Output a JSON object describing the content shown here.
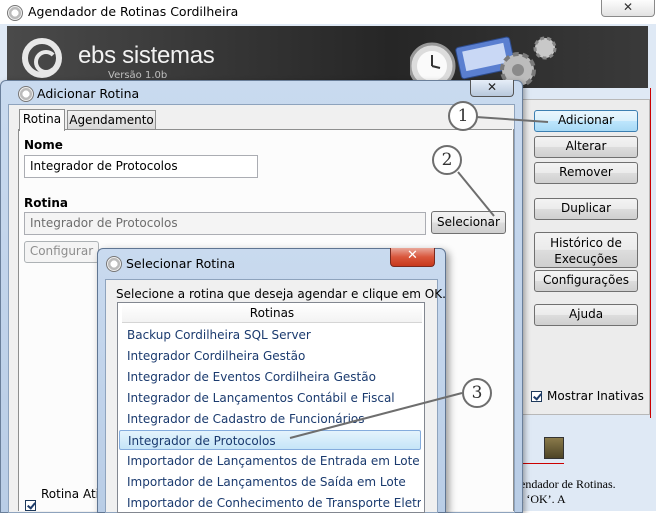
{
  "main_window": {
    "title": "Agendador de Rotinas Cordilheira",
    "close_glyph": "✕",
    "brand": "ebs sistemas",
    "version": "Versão 1.0b"
  },
  "right_panel": {
    "buttons": [
      {
        "label": "Adicionar"
      },
      {
        "label": "Alterar"
      },
      {
        "label": "Remover"
      },
      {
        "label": "Duplicar"
      },
      {
        "label": "Histórico de Execuções"
      },
      {
        "label": "Configurações"
      },
      {
        "label": "Ajuda"
      }
    ],
    "show_inactive_label": "Mostrar Inativas",
    "show_inactive_checked": true
  },
  "add_dialog": {
    "title": "Adicionar Rotina",
    "close_glyph": "✕",
    "tabs": [
      {
        "label": "Rotina",
        "selected": true
      },
      {
        "label": "Agendamento",
        "selected": false
      }
    ],
    "nome_label": "Nome",
    "nome_value": "Integrador de Protocolos",
    "rotina_label": "Rotina",
    "rotina_value": "Integrador de Protocolos",
    "selecionar_label": "Selecionar",
    "configurar_label": "Configurar",
    "active_label": "Rotina Ativ",
    "active_checked": true
  },
  "select_dialog": {
    "title": "Selecionar Rotina",
    "close_glyph": "✕",
    "instruction": "Selecione a rotina que deseja agendar e clique em OK.",
    "column_header": "Rotinas",
    "items": [
      {
        "label": "Backup Cordilheira SQL Server"
      },
      {
        "label": "Integrador Cordilheira Gestão"
      },
      {
        "label": "Integrador de Eventos Cordilheira Gestão"
      },
      {
        "label": "Integrador de Lançamentos Contábil e Fiscal"
      },
      {
        "label": "Integrador de Cadastro de Funcionários"
      },
      {
        "label": "Integrador de Protocolos"
      },
      {
        "label": "Importador de Lançamentos de Entrada em Lote"
      },
      {
        "label": "Importador de Lançamentos de Saída em Lote"
      },
      {
        "label": "Importador de Conhecimento de Transporte Eletrônico"
      }
    ],
    "selected_index": 5
  },
  "callouts": [
    "1",
    "2",
    "3"
  ],
  "background_doc": {
    "line1": "gendador de Rotinas.",
    "line2": "m ‘OK’. A"
  },
  "colors": {
    "selection": "#c5e5f8",
    "close_red": "#c7381c",
    "frame": "#b9cde6"
  }
}
